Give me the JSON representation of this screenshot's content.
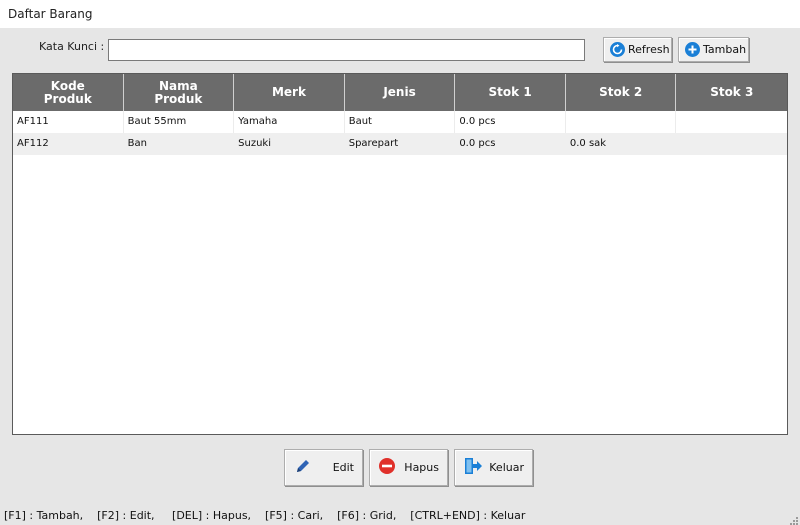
{
  "window": {
    "title": "Daftar Barang"
  },
  "search": {
    "label": "Kata Kunci :",
    "value": "",
    "placeholder": ""
  },
  "toolbar": {
    "refresh_label": "Refresh",
    "tambah_label": "Tambah"
  },
  "table": {
    "columns": [
      "Kode\nProduk",
      "Nama\nProduk",
      "Merk",
      "Jenis",
      "Stok 1",
      "Stok 2",
      "Stok 3"
    ],
    "rows": [
      [
        "AF111",
        "Baut 55mm",
        "Yamaha",
        "Baut",
        "0.0 pcs",
        "",
        ""
      ],
      [
        "AF112",
        "Ban",
        "Suzuki",
        "Sparepart",
        "0.0 pcs",
        "0.0 sak",
        ""
      ]
    ]
  },
  "actions": {
    "edit_label": "Edit",
    "hapus_label": "Hapus",
    "keluar_label": "Keluar"
  },
  "statusbar": {
    "text": "[F1] : Tambah,    [F2] : Edit,     [DEL] : Hapus,    [F5] : Cari,    [F6] : Grid,    [CTRL+END] : Keluar"
  },
  "colors": {
    "header_bg": "#6b6b6b",
    "refresh_icon": "#1a7fd6",
    "tambah_icon": "#1a7fd6",
    "hapus_icon": "#e0302a",
    "keluar_icon": "#1a7fd6",
    "edit_icon": "#2f64b5"
  },
  "icons": {
    "refresh": "refresh-icon",
    "tambah": "plus-icon",
    "edit": "pencil-icon",
    "hapus": "minus-icon",
    "keluar": "exit-icon"
  }
}
